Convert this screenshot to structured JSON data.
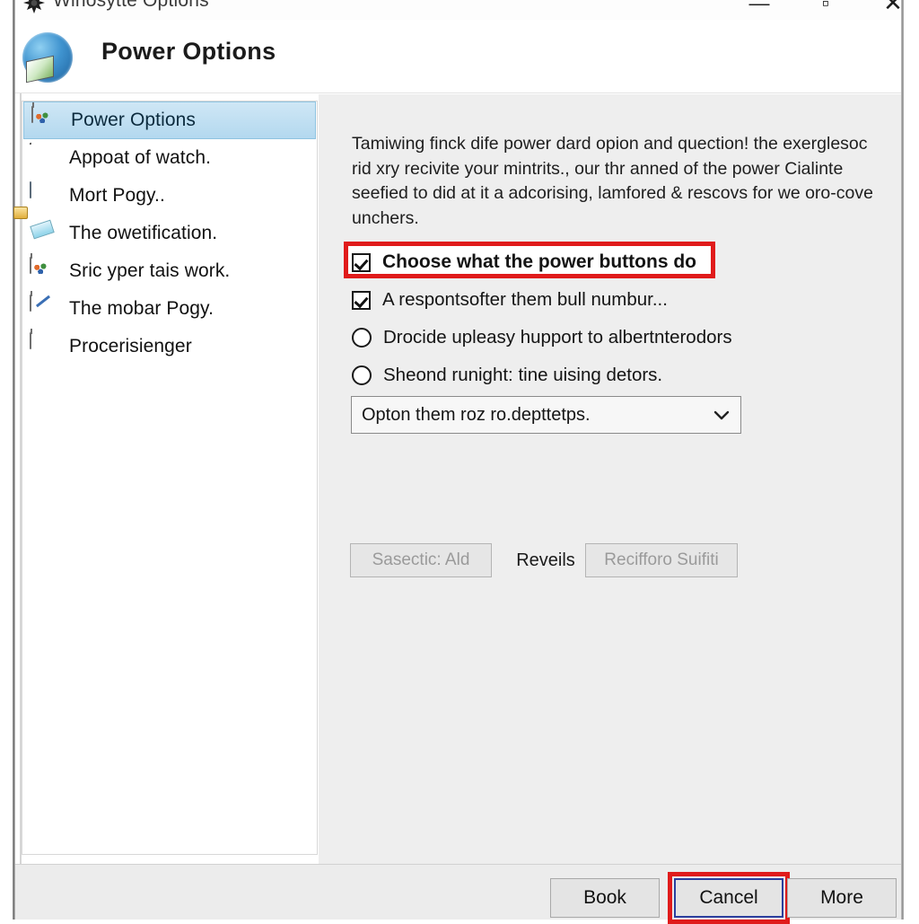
{
  "window": {
    "title": "Winosytte Options",
    "title_icon": "starburst-icon",
    "minimize_label": "—",
    "maximize_label": "▫",
    "close_label": "✕"
  },
  "header": {
    "title": "Power Options",
    "icon": "globe-power-icon"
  },
  "sidebar": {
    "items": [
      {
        "label": "Power Options",
        "icon": "power-options-icon",
        "selected": true
      },
      {
        "label": "Appoat of watch.",
        "icon": "globe-user-icon",
        "selected": false
      },
      {
        "label": "Mort Pogy..",
        "icon": "battery-icon",
        "selected": false
      },
      {
        "label": "The owetification.",
        "icon": "lock-icon",
        "selected": false
      },
      {
        "label": "Sric yper tais work.",
        "icon": "briefcase-blue-icon",
        "selected": false
      },
      {
        "label": "The mobar Pogy.",
        "icon": "briefcase-pen-icon",
        "selected": false
      },
      {
        "label": "Procerisienger",
        "icon": "briefcase-green-icon",
        "selected": false
      }
    ]
  },
  "content": {
    "description": "Tamiwing finck dife power dard opion and quection! the exerglesoc rid xry recivite your mintrits., our thr anned of the power Cialinte seefied to did at it a adcorising, lamfored & rescovs for we oro-cove unchers.",
    "options": [
      {
        "label": "Choose what the power buttons do",
        "type": "checkbox",
        "checked": true,
        "highlighted": true
      },
      {
        "label": "A respontsofter them bull numbur...",
        "type": "checkbox",
        "checked": true,
        "highlighted": false
      },
      {
        "label": "Drocide upleasy hupport to albertnterodors",
        "type": "radio",
        "checked": false,
        "highlighted": false
      },
      {
        "label": "Sheond runight: tine uising detors.",
        "type": "radio",
        "checked": false,
        "highlighted": false
      }
    ],
    "dropdown": {
      "value": "Opton them roz ro.depttetps.",
      "arrow_icon": "chevron-down-icon"
    },
    "mid_buttons": {
      "left_label": "Sasectic: Ald",
      "center_label": "Reveils",
      "right_label": "Recifforo Suifiti"
    }
  },
  "footer": {
    "buttons": [
      {
        "label": "Book",
        "highlighted": false
      },
      {
        "label": "Cancel",
        "highlighted": true
      },
      {
        "label": "More",
        "highlighted": false
      }
    ]
  },
  "colors": {
    "highlight_red": "#e01b1b",
    "focus_blue": "#2b3f9e",
    "selection_blue": "#b3d8ef",
    "content_bg": "#eeeeee"
  }
}
